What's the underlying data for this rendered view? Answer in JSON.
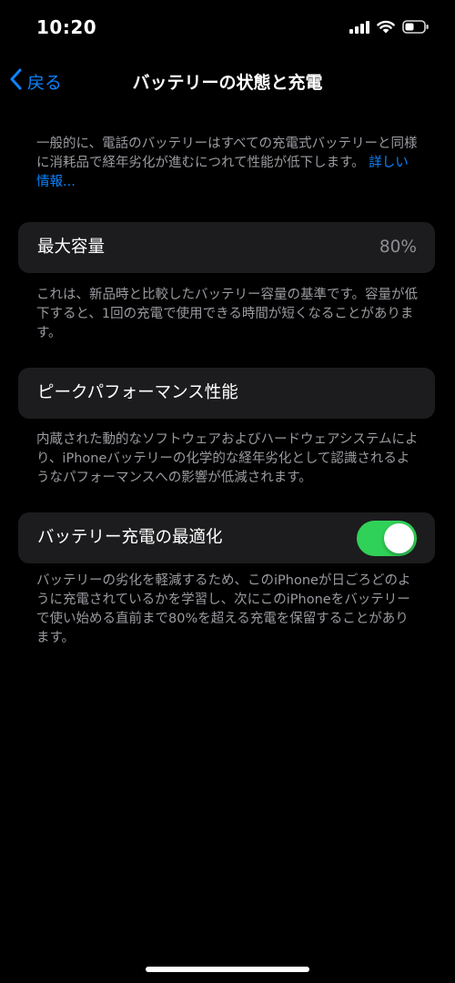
{
  "status_bar": {
    "time": "10:20"
  },
  "nav": {
    "back_label": "戻る",
    "title": "バッテリーの状態と充電"
  },
  "intro": {
    "text": "一般的に、電話のバッテリーはすべての充電式バッテリーと同様に消耗品で経年劣化が進むにつれて性能が低下します。",
    "link": "詳しい情報..."
  },
  "max_capacity": {
    "label": "最大容量",
    "value": "80%",
    "footnote": "これは、新品時と比較したバッテリー容量の基準です。容量が低下すると、1回の充電で使用できる時間が短くなることがあります。"
  },
  "peak_performance": {
    "label": "ピークパフォーマンス性能",
    "footnote": "内蔵された動的なソフトウェアおよびハードウェアシステムにより、iPhoneバッテリーの化学的な経年劣化として認識されるようなパフォーマンスへの影響が低減されます。"
  },
  "optimized_charging": {
    "label": "バッテリー充電の最適化",
    "enabled": true,
    "footnote": "バッテリーの劣化を軽減するため、このiPhoneが日ごろどのように充電されているかを学習し、次にこのiPhoneをバッテリーで使い始める直前まで80%を超える充電を保留することがあります。"
  },
  "colors": {
    "accent": "#0a84ff",
    "toggle_on": "#30d158",
    "cell_background": "#1c1c1e",
    "secondary_text": "#9a9aa0"
  },
  "icons": [
    "cellular-signal-icon",
    "wifi-icon",
    "battery-icon",
    "chevron-left-icon"
  ]
}
